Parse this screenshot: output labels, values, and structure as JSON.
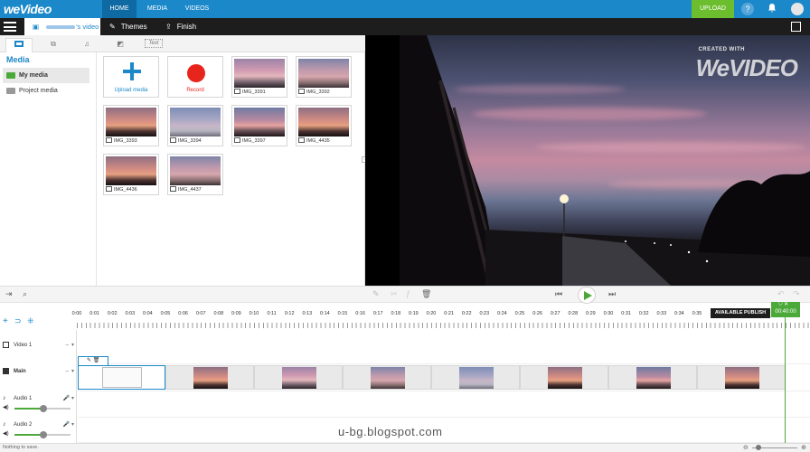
{
  "app": {
    "logo": "weVideo"
  },
  "topnav": {
    "items": [
      "HOME",
      "MEDIA",
      "VIDEOS"
    ],
    "active": "HOME",
    "upload_label": "UPLOAD"
  },
  "secondary": {
    "project_label": "'s video",
    "themes_label": "Themes",
    "finish_label": "Finish"
  },
  "media_panel": {
    "title": "Media",
    "tabs": [
      "video-tab",
      "transitions-tab",
      "music-tab",
      "graphics-tab",
      "Text"
    ],
    "library": [
      {
        "label": "My media",
        "active": true,
        "color": "#4aa938"
      },
      {
        "label": "Project media",
        "active": false,
        "color": "#999999"
      }
    ],
    "actions": {
      "upload_label": "Upload media",
      "record_label": "Record"
    },
    "files": [
      "IMG_3391",
      "IMG_3392",
      "IMG_3393",
      "IMG_3394",
      "IMG_3397",
      "IMG_4435",
      "IMG_4436",
      "IMG_4437"
    ]
  },
  "preview": {
    "watermark_small": "CREATED WITH",
    "watermark_big": "WeVIDEO"
  },
  "timeline": {
    "ruler_labels": [
      "0:00",
      "0:01",
      "0:02",
      "0:03",
      "0:04",
      "0:05",
      "0:06",
      "0:07",
      "0:08",
      "0:09",
      "0:10",
      "0:11",
      "0:12",
      "0:13",
      "0:14",
      "0:15",
      "0:16",
      "0:17",
      "0:18",
      "0:19",
      "0:20",
      "0:21",
      "0:22",
      "0:23",
      "0:24",
      "0:25",
      "0:26",
      "0:27",
      "0:28",
      "0:29",
      "0:30",
      "0:31",
      "0:32",
      "0:33",
      "0:34",
      "0:35"
    ],
    "publish_tip": "AVAILABLE PUBLISH TIME",
    "playhead_time": "00:40:00",
    "tracks": [
      {
        "name": "Video 1",
        "type": "video"
      },
      {
        "name": "Main",
        "type": "video",
        "bold": true
      },
      {
        "name": "Audio 1",
        "type": "audio"
      },
      {
        "name": "Audio 2",
        "type": "audio"
      }
    ],
    "volume_level": 0.45
  },
  "status": {
    "text": "Nothing to save."
  },
  "credit": {
    "text": "u-bg.blogspot.com"
  },
  "colors": {
    "brand_blue": "#1b88c9",
    "accent_green": "#4aa938",
    "record_red": "#e8251c"
  }
}
